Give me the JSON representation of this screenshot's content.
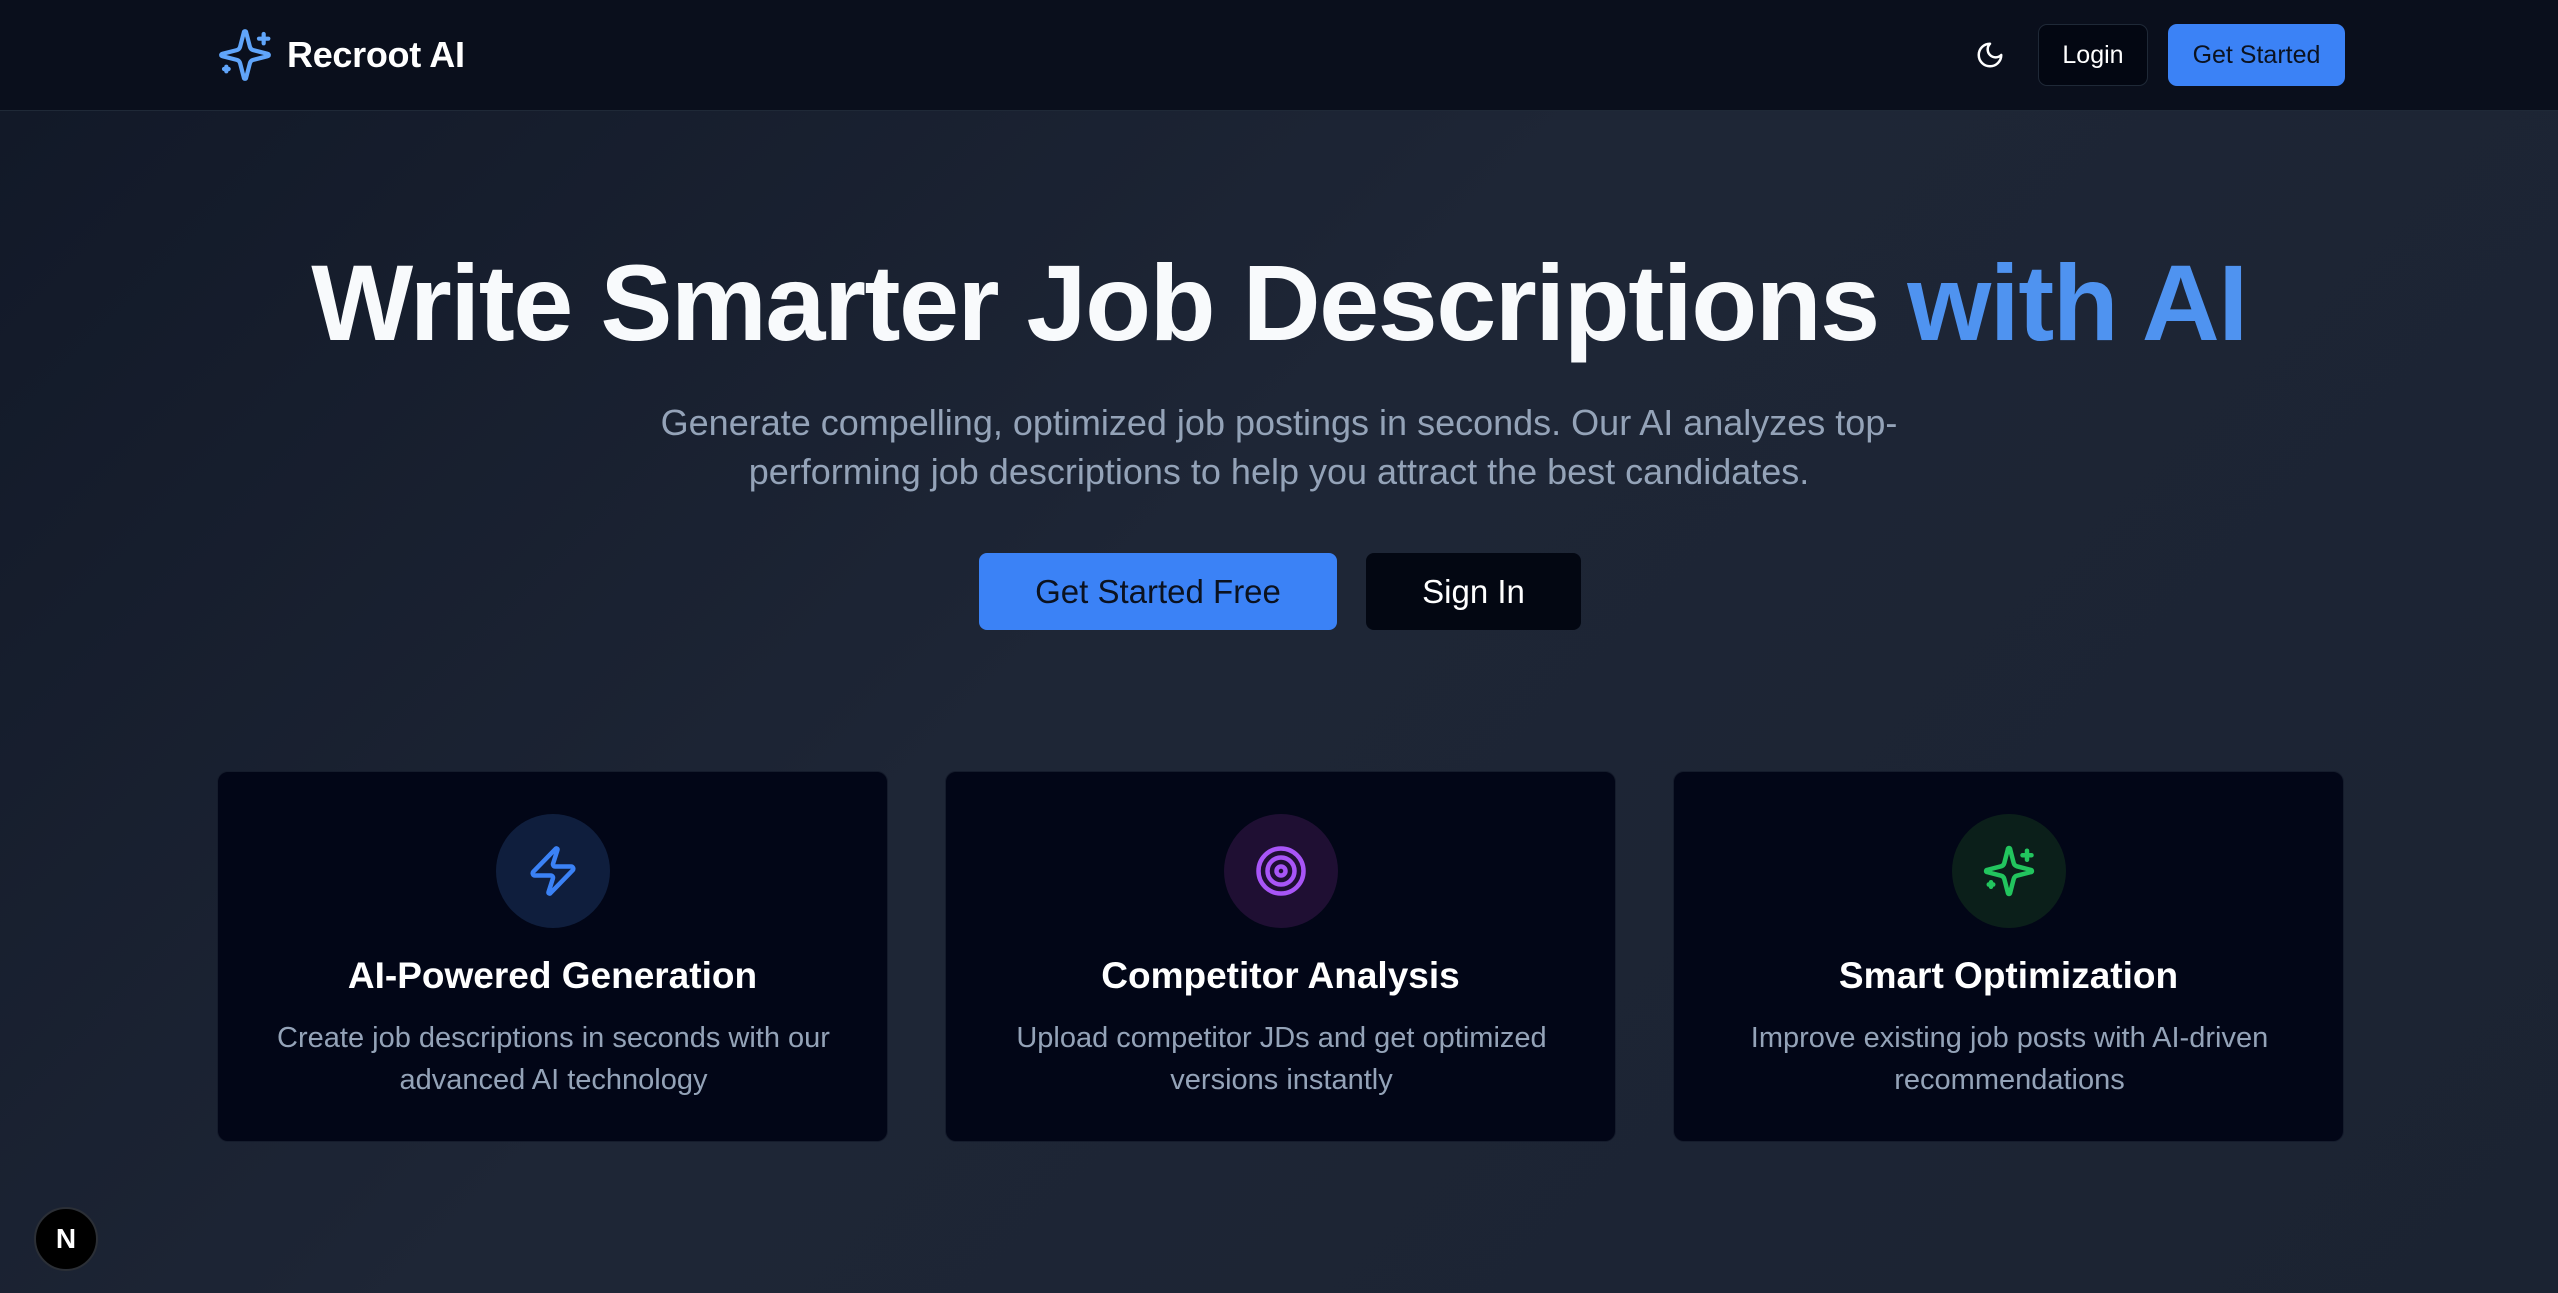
{
  "header": {
    "brand_name": "Recroot AI",
    "login_label": "Login",
    "get_started_label": "Get Started"
  },
  "hero": {
    "title_main": "Write Smarter Job Descriptions ",
    "title_accent": "with AI",
    "subtitle": "Generate compelling, optimized job postings in seconds. Our AI analyzes top-performing job descriptions to help you attract the best candidates.",
    "cta_primary": "Get Started Free",
    "cta_secondary": "Sign In"
  },
  "features": [
    {
      "icon": "lightning-icon",
      "title": "AI-Powered Generation",
      "description": "Create job descriptions in seconds with our advanced AI technology",
      "accent_color": "#3b82f6"
    },
    {
      "icon": "target-icon",
      "title": "Competitor Analysis",
      "description": "Upload competitor JDs and get optimized versions instantly",
      "accent_color": "#a855f7"
    },
    {
      "icon": "sparkles-icon",
      "title": "Smart Optimization",
      "description": "Improve existing job posts with AI-driven recommendations",
      "accent_color": "#22c55e"
    }
  ],
  "dev_badge": {
    "label": "N"
  },
  "colors": {
    "accent": "#3b82f6",
    "accent_text": "#4f93f0",
    "background": "#1e2636",
    "header_bg": "#0a0f1c",
    "card_bg": "#020617",
    "muted_text": "#94a3b8"
  }
}
